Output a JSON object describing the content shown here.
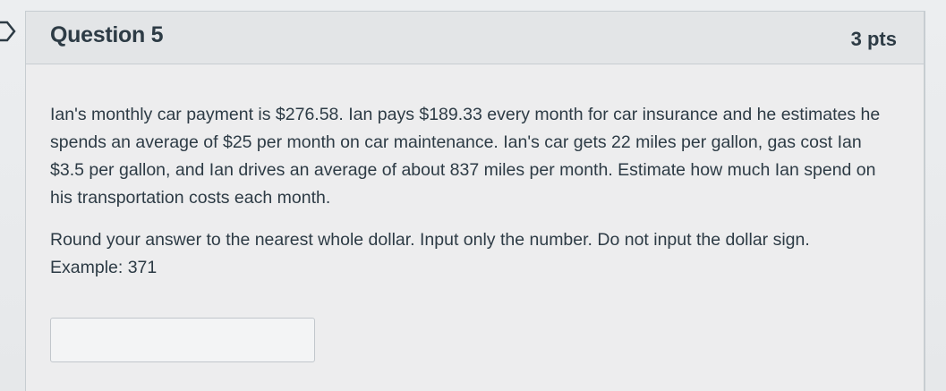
{
  "question": {
    "title": "Question 5",
    "points": "3 pts",
    "paragraph1": "Ian's monthly car payment is $276.58.  Ian pays $189.33 every month for car insurance and he estimates he spends an average of $25 per month on car maintenance.  Ian's car gets 22 miles per gallon, gas cost Ian $3.5 per gallon, and Ian drives an average of about 837 miles per month.  Estimate how much Ian spend on his transportation costs each month.",
    "paragraph2": "Round your answer to the nearest whole dollar.  Input only the number.  Do not input the dollar sign.  Example: 371",
    "answer_value": ""
  },
  "icons": {
    "flag": "flag-icon"
  },
  "colors": {
    "text": "#2d3b45",
    "border": "#c7cdd1",
    "header_bg": "#e3e5e7"
  }
}
